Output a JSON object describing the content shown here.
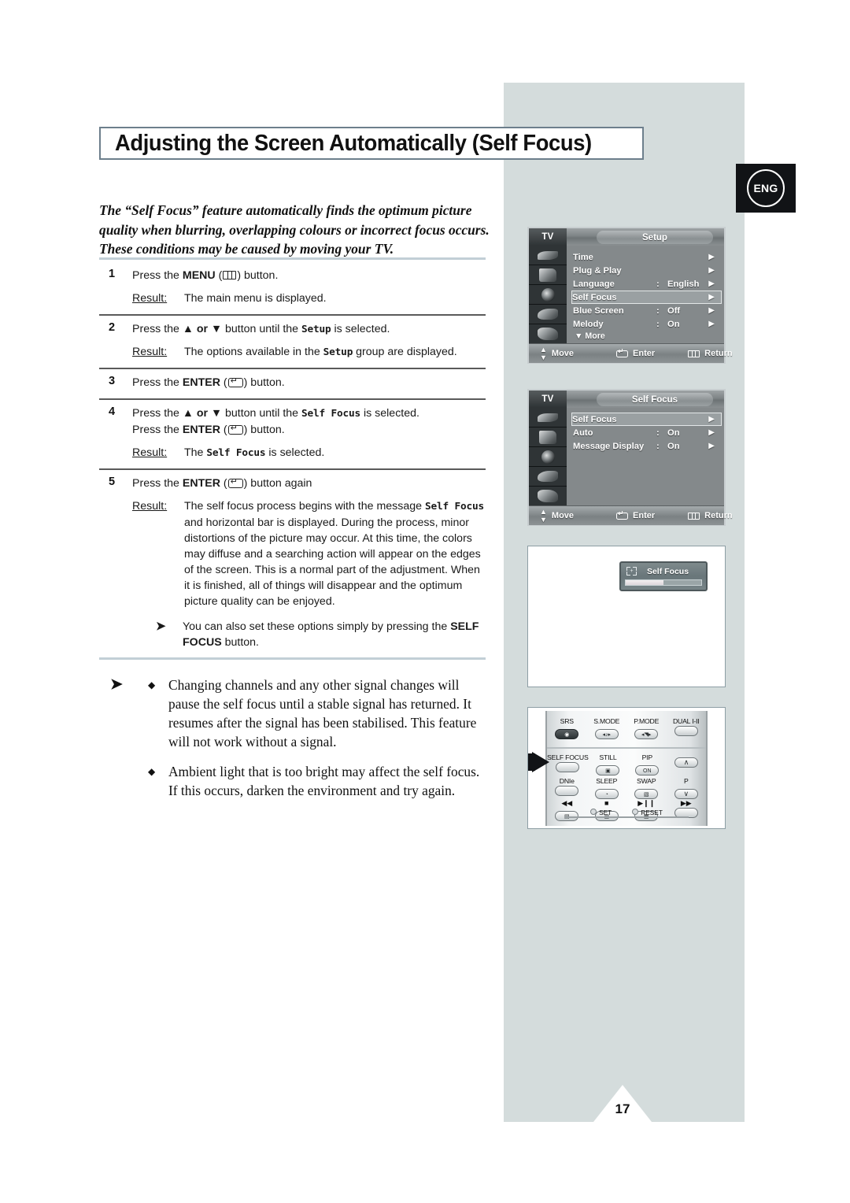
{
  "page": {
    "title": "Adjusting the Screen Automatically (Self Focus)",
    "language_badge": "ENG",
    "page_number": "17"
  },
  "intro": "The “Self Focus” feature automatically finds the optimum picture quality when blurring, overlapping colours or incorrect focus occurs. These conditions may be caused by moving your TV.",
  "steps": [
    {
      "num": "1",
      "line_pre": "Press the ",
      "line_bold": "MENU",
      "line_mid": " (",
      "line_post": ") button.",
      "result_label": "Result:",
      "result": "The main menu is displayed."
    },
    {
      "num": "2",
      "line_pre": "Press the ",
      "line_bold": "▲ or ▼",
      "line_mid": " button until the ",
      "line_mono": "Setup",
      "line_post": " is selected.",
      "result_label": "Result:",
      "result_pre": "The options available in the ",
      "result_mono": "Setup",
      "result_post": " group are displayed."
    },
    {
      "num": "3",
      "line_pre": "Press the ",
      "line_bold": "ENTER",
      "line_mid": " (",
      "line_post": ") button."
    },
    {
      "num": "4",
      "line_pre": "Press the ",
      "line_bold": "▲ or ▼",
      "line_mid": " button until the ",
      "line_mono": "Self Focus",
      "line_post": " is selected.",
      "line2_pre": "Press the ",
      "line2_bold": "ENTER",
      "line2_mid": " (",
      "line2_post": ") button.",
      "result_label": "Result:",
      "result_pre": "The ",
      "result_mono": "Self Focus",
      "result_post": " is selected."
    },
    {
      "num": "5",
      "line_pre": "Press the ",
      "line_bold": "ENTER",
      "line_mid": " (",
      "line_post": ") button again",
      "result_label": "Result:",
      "result_pre": "The self focus process begins with the message ",
      "result_mono": "Self Focus",
      "result_post": " and horizontal bar is displayed. During the process, minor distortions of the picture may occur. At this time, the colors may diffuse and a searching action will appear on the edges of the screen. This is a normal part of the adjustment. When it is finished, all of things will disappear and the optimum picture quality can be enjoyed.",
      "note_pre": "You can also set these options simply by pressing the ",
      "note_bold": "SELF FOCUS",
      "note_post": " button."
    }
  ],
  "bottom_notes": {
    "arrow": "➤",
    "diamond": "◆",
    "items": [
      "Changing channels and any other signal changes will pause the self focus until a stable signal has returned. It resumes after the signal has been stabilised. This feature will not work without a signal.",
      "Ambient light that is too bright may affect the self focus. If this occurs, darken the environment and try again."
    ]
  },
  "osd_menu_setup": {
    "source_label": "TV",
    "tab_label": "Setup",
    "rows": [
      {
        "label": "Time",
        "colon": "",
        "value": "",
        "caret": "▶",
        "selected": false
      },
      {
        "label": "Plug & Play",
        "colon": "",
        "value": "",
        "caret": "▶",
        "selected": false
      },
      {
        "label": "Language",
        "colon": ":",
        "value": "English",
        "caret": "▶",
        "selected": false
      },
      {
        "label": "Self Focus",
        "colon": "",
        "value": "",
        "caret": "▶",
        "selected": true
      },
      {
        "label": "Blue Screen",
        "colon": ":",
        "value": "Off",
        "caret": "▶",
        "selected": false
      },
      {
        "label": "Melody",
        "colon": ":",
        "value": "On",
        "caret": "▶",
        "selected": false
      }
    ],
    "more_label": "▼ More",
    "footer": {
      "move": "Move",
      "enter": "Enter",
      "return": "Return"
    }
  },
  "osd_menu_selffocus": {
    "source_label": "TV",
    "tab_label": "Self Focus",
    "rows": [
      {
        "label": "Self Focus",
        "colon": "",
        "value": "",
        "caret": "▶",
        "selected": true
      },
      {
        "label": "Auto",
        "colon": ":",
        "value": "On",
        "caret": "▶",
        "selected": false
      },
      {
        "label": "Message Display",
        "colon": ":",
        "value": "On",
        "caret": "▶",
        "selected": false
      }
    ],
    "footer": {
      "move": "Move",
      "enter": "Enter",
      "return": "Return"
    }
  },
  "self_focus_popup": {
    "title": "Self Focus",
    "progress_percent": 50
  },
  "remote": {
    "row_top": [
      {
        "label": "SRS",
        "style": "dark",
        "symbol": "◉"
      },
      {
        "label": "S.MODE",
        "style": "light",
        "symbol": "◂♪▸"
      },
      {
        "label": "P.MODE",
        "style": "light",
        "symbol": "◂◥▸"
      },
      {
        "label": "DUAL I-II",
        "style": "light",
        "symbol": ""
      }
    ],
    "row_2": [
      {
        "label": "SELF FOCUS",
        "symbol": ""
      },
      {
        "label": "STILL",
        "symbol": "▣"
      },
      {
        "label": "PIP",
        "symbol": "ON"
      },
      {
        "label": "",
        "symbol": "∧"
      }
    ],
    "row_3": [
      {
        "label": "DNIe",
        "symbol": ""
      },
      {
        "label": "SLEEP",
        "symbol": "◔"
      },
      {
        "label": "SWAP",
        "symbol": "▧"
      },
      {
        "label": "P",
        "symbol": "∨"
      }
    ],
    "row_4": [
      {
        "label": "◀◀",
        "symbol": "▤"
      },
      {
        "label": "■",
        "symbol": "▥"
      },
      {
        "label": "▶❙❙",
        "symbol": "▦"
      },
      {
        "label": "▶▶",
        "symbol": ""
      }
    ],
    "bottom": [
      {
        "label": "SET"
      },
      {
        "label": "RESET"
      }
    ]
  }
}
